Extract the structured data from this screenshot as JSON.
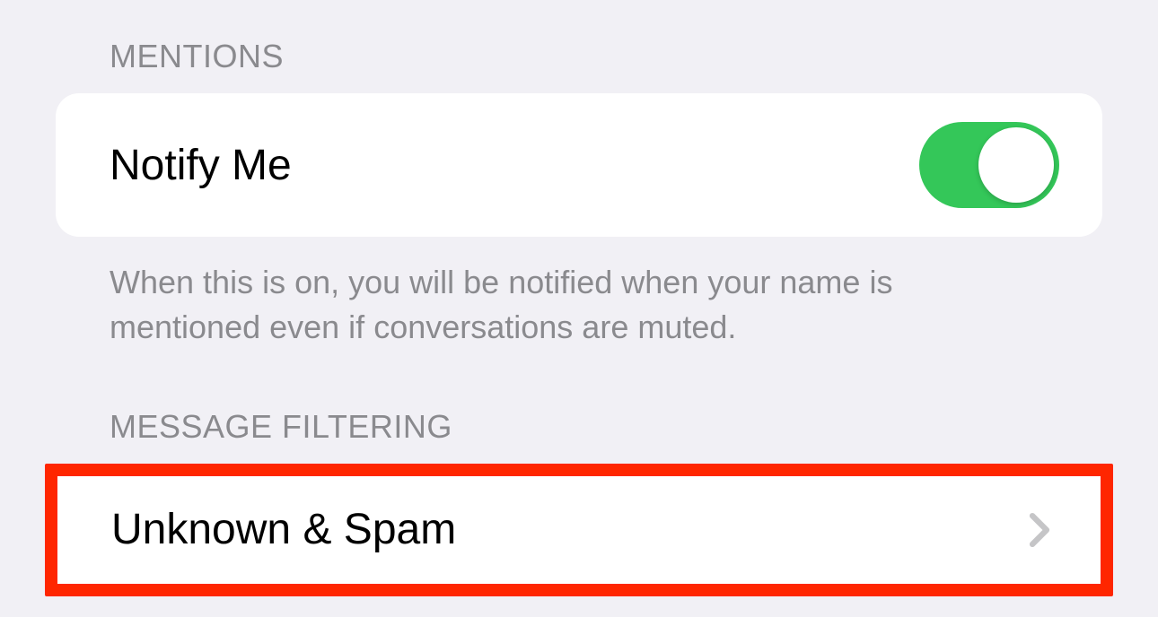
{
  "mentions": {
    "header": "MENTIONS",
    "notify_me_label": "Notify Me",
    "notify_me_on": true,
    "footer": "When this is on, you will be notified when your name is mentioned even if conversations are muted."
  },
  "message_filtering": {
    "header": "MESSAGE FILTERING",
    "unknown_spam_label": "Unknown & Spam"
  },
  "colors": {
    "toggle_on": "#34c759",
    "highlight": "#ff2600",
    "bg": "#f1f0f5",
    "secondary_text": "#8a8a8e"
  }
}
